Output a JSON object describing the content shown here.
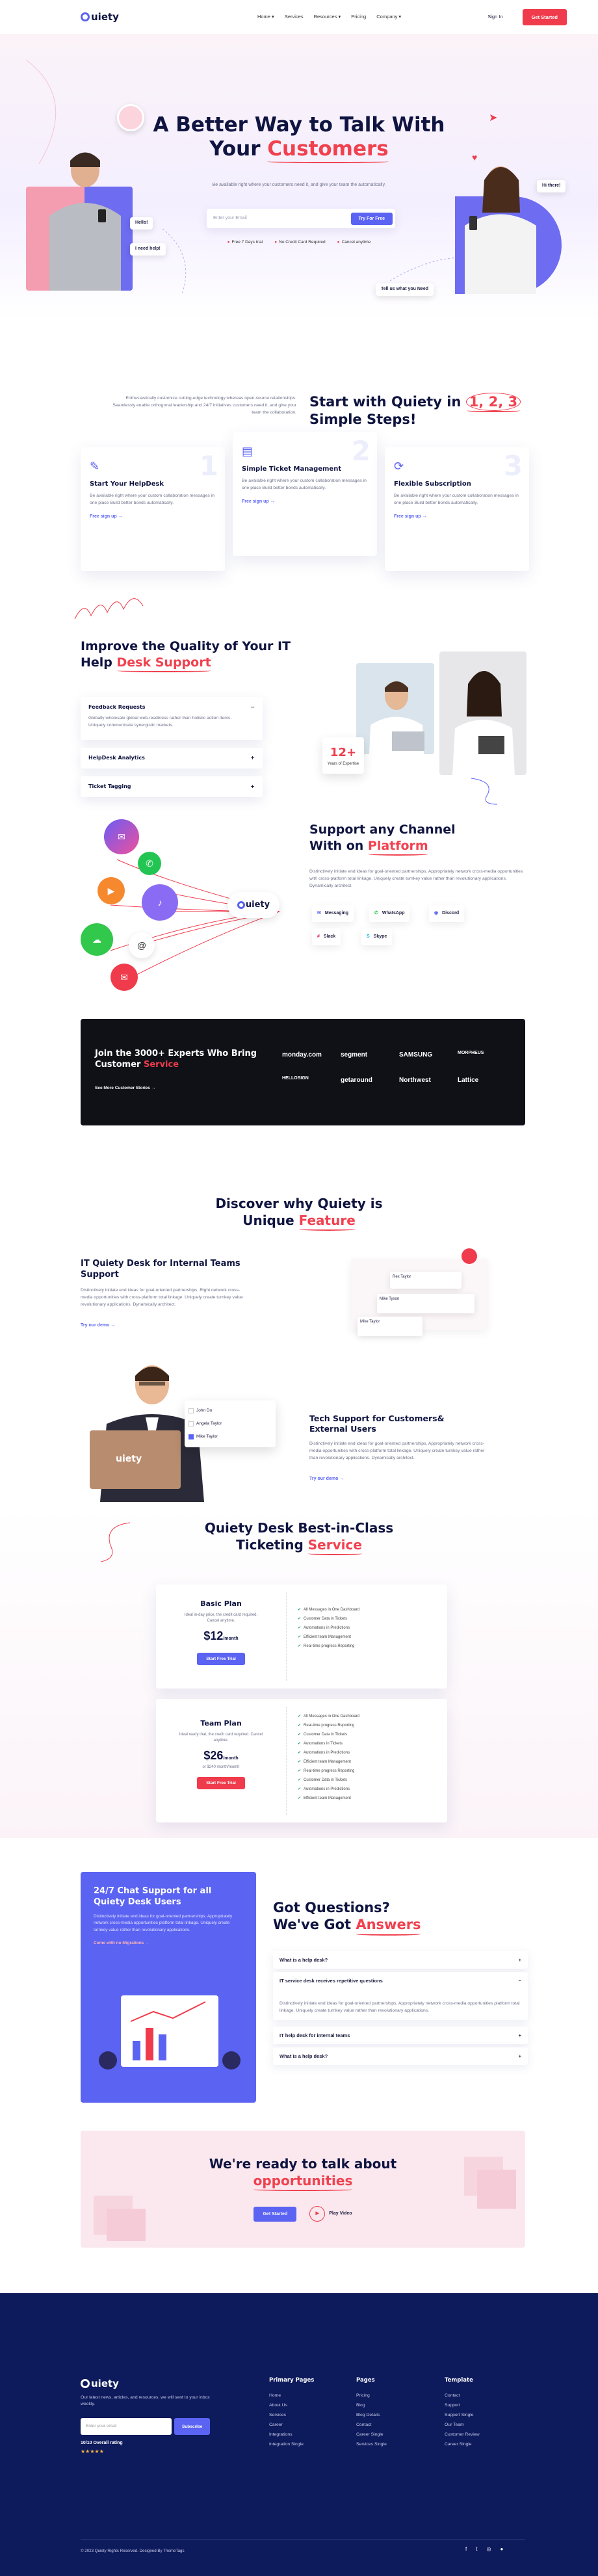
{
  "header": {
    "logo": "uiety",
    "nav": [
      "Home ▾",
      "Services",
      "Resources ▾",
      "Pricing",
      "Company ▾"
    ],
    "signin": "Sign In",
    "cta": "Get Started"
  },
  "hero": {
    "title_line1": "A Better Way to Talk With",
    "title_line2_plain": "Your ",
    "title_line2_accent": "Customers",
    "subtitle": "Be available right where your customers need it, and give your team the automatically.",
    "email_placeholder": "Enter your Email",
    "email_button": "Try For Free",
    "checks": [
      "Free 7 Days trial",
      "No Credit Card Required",
      "Cancel anytime"
    ],
    "bubble_hello": "Hello!",
    "bubble_help": "I need help!",
    "bubble_hi": "Hi there!",
    "bubble_tell": "Tell us what you Need"
  },
  "steps": {
    "intro": "Enthusiastically customize cutting-edge technology whereas open-source relationships. Seamlessly enable orthogonal leadership and 24/7 initiatives customers need it, and give your team the collaboration.",
    "title_plain": "Start with Quiety in ",
    "title_accent": "1, 2, 3",
    "title_line2": "Simple Steps!",
    "cards": [
      {
        "num": "1",
        "title": "Start Your HelpDesk",
        "text": "Be available right where your custom collaboration messages in one place Build better bonds automatically.",
        "link": "Free sign up →"
      },
      {
        "num": "2",
        "title": "Simple Ticket Management",
        "text": "Be available right where your custom collaboration messages in one place Build better bonds automatically.",
        "link": "Free sign up →"
      },
      {
        "num": "3",
        "title": "Flexible Subscription",
        "text": "Be available right where your custom collaboration messages in one place Build better bonds automatically.",
        "link": "Free sign up →"
      }
    ]
  },
  "improve": {
    "title_line1": "Improve the Quality of Your IT",
    "title_plain": "Help ",
    "title_accent": "Desk Support",
    "items": [
      {
        "title": "Feedback Requests",
        "text": "Globally wholesale global web-readiness rather than holistic action items. Uniquely communicate synergistic markets.",
        "open": true
      },
      {
        "title": "HelpDesk Analytics",
        "open": false
      },
      {
        "title": "Ticket Tagging",
        "open": false
      }
    ],
    "badge_num": "12+",
    "badge_text": "Years of Expertise"
  },
  "channels": {
    "title_line1": "Support any Channel",
    "title_plain": "With on ",
    "title_accent": "Platform",
    "text": "Distinctively initiate end ideas for goal-oriented partnerships. Appropriately network cross-media opportunities with cross-platform total linkage. Uniquely create turnkey value rather than revolutionary applications. Dynamically architect.",
    "buttons": [
      "Messaging",
      "WhatsApp",
      "Discord",
      "Slack",
      "Skype"
    ],
    "logo": "uiety"
  },
  "experts": {
    "title": "Join the 3000+ Experts Who Bring",
    "title2_plain": "Customer ",
    "title2_accent": "Service",
    "link": "See More Customer Stories →",
    "logos": [
      "monday.com",
      "segment",
      "SAMSUNG",
      "MORPHEUS",
      "HELLOSIGN",
      "getaround",
      "Northwest",
      "Lattice"
    ]
  },
  "discover": {
    "title_line1": "Discover why Quiety is",
    "title_plain": "Unique ",
    "title_accent": "Feature",
    "f1_title": "IT Quiety Desk for Internal Teams Support",
    "f1_text": "Distinctively initiate end ideas for goal-oriented partnerships. Right network cross-media opportunities with cross-platform total linkage. Uniquely create turnkey value revolutionary applications. Dynamically architect.",
    "f1_link": "Try our demo →",
    "mock_names": [
      "Rex Taylor",
      "Mike Tyson",
      "Mike Taylor"
    ],
    "f2_title": "Tech Support for Customers& External Users",
    "f2_text": "Distinctively initiate end ideas for goal-oriented partnerships. Appropriately network cross-media opportunities with cross-platform total linkage. Uniquely create turnkey value rather than revolutionary applications. Dynamically architect.",
    "f2_link": "Try our demo →",
    "laptop_logo": "uiety",
    "list_names": [
      "John Do",
      "Angela Taylor",
      "Mike Taylor"
    ]
  },
  "pricing": {
    "title_line1": "Quiety Desk Best-in-Class",
    "title_plain": "Ticketing ",
    "title_accent": "Service",
    "plans": [
      {
        "name": "Basic Plan",
        "desc": "Ideal in-day price, the credit card required. Cancel anytime.",
        "price": "$12",
        "per": "/month",
        "cta": "Start Free Trial",
        "features": [
          "All Messages in One Dashboard",
          "Customer Data in Tickets",
          "Automations in Predictions",
          "Efficient team Management",
          "Real-time progress Reporting"
        ]
      },
      {
        "name": "Team Plan",
        "desc": "Ideal ready that, the credit card required. Cancel anytime.",
        "price": "$26",
        "per": "/month",
        "note": "or $240 month/month",
        "cta": "Start Free Trial",
        "features": [
          "All Messages in One Dashboard",
          "Real-time progress Reporting",
          "Customer Data in Tickets",
          "Automations in Tickets",
          "Automations in Predictions",
          "Efficient team Management",
          "Real-time progress Reporting",
          "Customer Data in Tickets",
          "Automations in Predictions",
          "Efficient team Management"
        ]
      }
    ]
  },
  "support": {
    "title": "24/7 Chat Support for all Quiety Desk Users",
    "text": "Distinctively initiate end ideas for goal-oriented partnerships. Appropriately network cross-media opportunities platform total linkage. Uniquely create turnkey value rather than revolutionary applications.",
    "link": "Come with no Migrations →"
  },
  "faq": {
    "title_line1": "Got Questions?",
    "title_plain": "We've Got ",
    "title_accent": "Answers",
    "items": [
      {
        "q": "What is a help desk?",
        "open": false
      },
      {
        "q": "IT service desk receives repetitive questions",
        "a": "Distinctively initiate end ideas for goal-oriented partnerships. Appropriately network cross-media opportunities platform total linkage. Uniquely create turnkey value rather than revolutionary applications.",
        "open": true
      },
      {
        "q": "IT help desk for internal teams",
        "open": false
      },
      {
        "q": "What is a help desk?",
        "open": false
      }
    ]
  },
  "cta": {
    "title": "We're ready to talk about",
    "accent": "opportunities",
    "btn": "Get Started",
    "video": "Play Video"
  },
  "footer": {
    "logo": "uiety",
    "text": "Our latest news, articles, and resources, we will sent to your inbox weekly.",
    "email_placeholder": "Enter your email",
    "subscribe": "Subscribe",
    "rating": "10/10 Overall rating",
    "stars": "★★★★★",
    "cols": [
      {
        "title": "Primary Pages",
        "items": [
          "Home",
          "About Us",
          "Services",
          "Career",
          "Integrations",
          "Integration Single"
        ]
      },
      {
        "title": "Pages",
        "items": [
          "Pricing",
          "Blog",
          "Blog Details",
          "Contact",
          "Career Single",
          "Services Single"
        ]
      },
      {
        "title": "Template",
        "items": [
          "Contact",
          "Support",
          "Support Single",
          "Our Team",
          "Customer Review",
          "Career Single"
        ]
      }
    ],
    "copyright": "© 2023 Quiety Rights Reserved. Designed By ThemeTags"
  },
  "colors": {
    "accent": "#ef3b4b",
    "primary": "#5b63f2",
    "navy": "#0d1a5c"
  }
}
